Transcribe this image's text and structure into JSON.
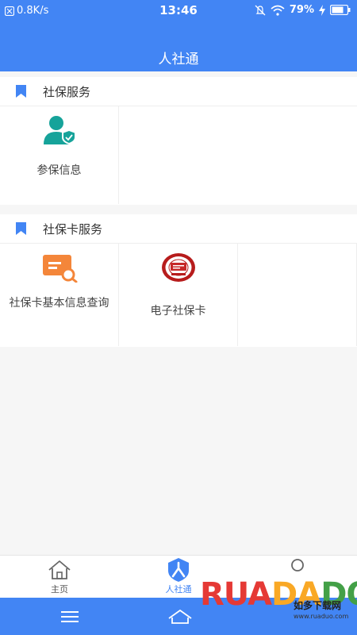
{
  "status_bar": {
    "net_speed": "0.8K/s",
    "time": "13:46",
    "battery": "79%"
  },
  "header": {
    "title": "人社通"
  },
  "sections": [
    {
      "title": "社保服务",
      "items": [
        {
          "label": "参保信息",
          "icon": "user-shield-icon"
        }
      ]
    },
    {
      "title": "社保卡服务",
      "items": [
        {
          "label": "社保卡基本信息查询",
          "icon": "card-search-icon"
        },
        {
          "label": "电子社保卡",
          "icon": "social-security-card-icon"
        }
      ]
    }
  ],
  "bottom_nav": [
    {
      "label": "主页",
      "icon": "home-icon"
    },
    {
      "label": "人社通",
      "icon": "person-icon",
      "active": true
    }
  ],
  "watermark": {
    "brand": "RUANDADO",
    "sub": "如多下载网",
    "url": "www.ruaduo.com"
  },
  "colors": {
    "primary": "#4285f4",
    "orange": "#f4863a",
    "teal": "#16a39a",
    "watermark_red": "#e53935"
  }
}
